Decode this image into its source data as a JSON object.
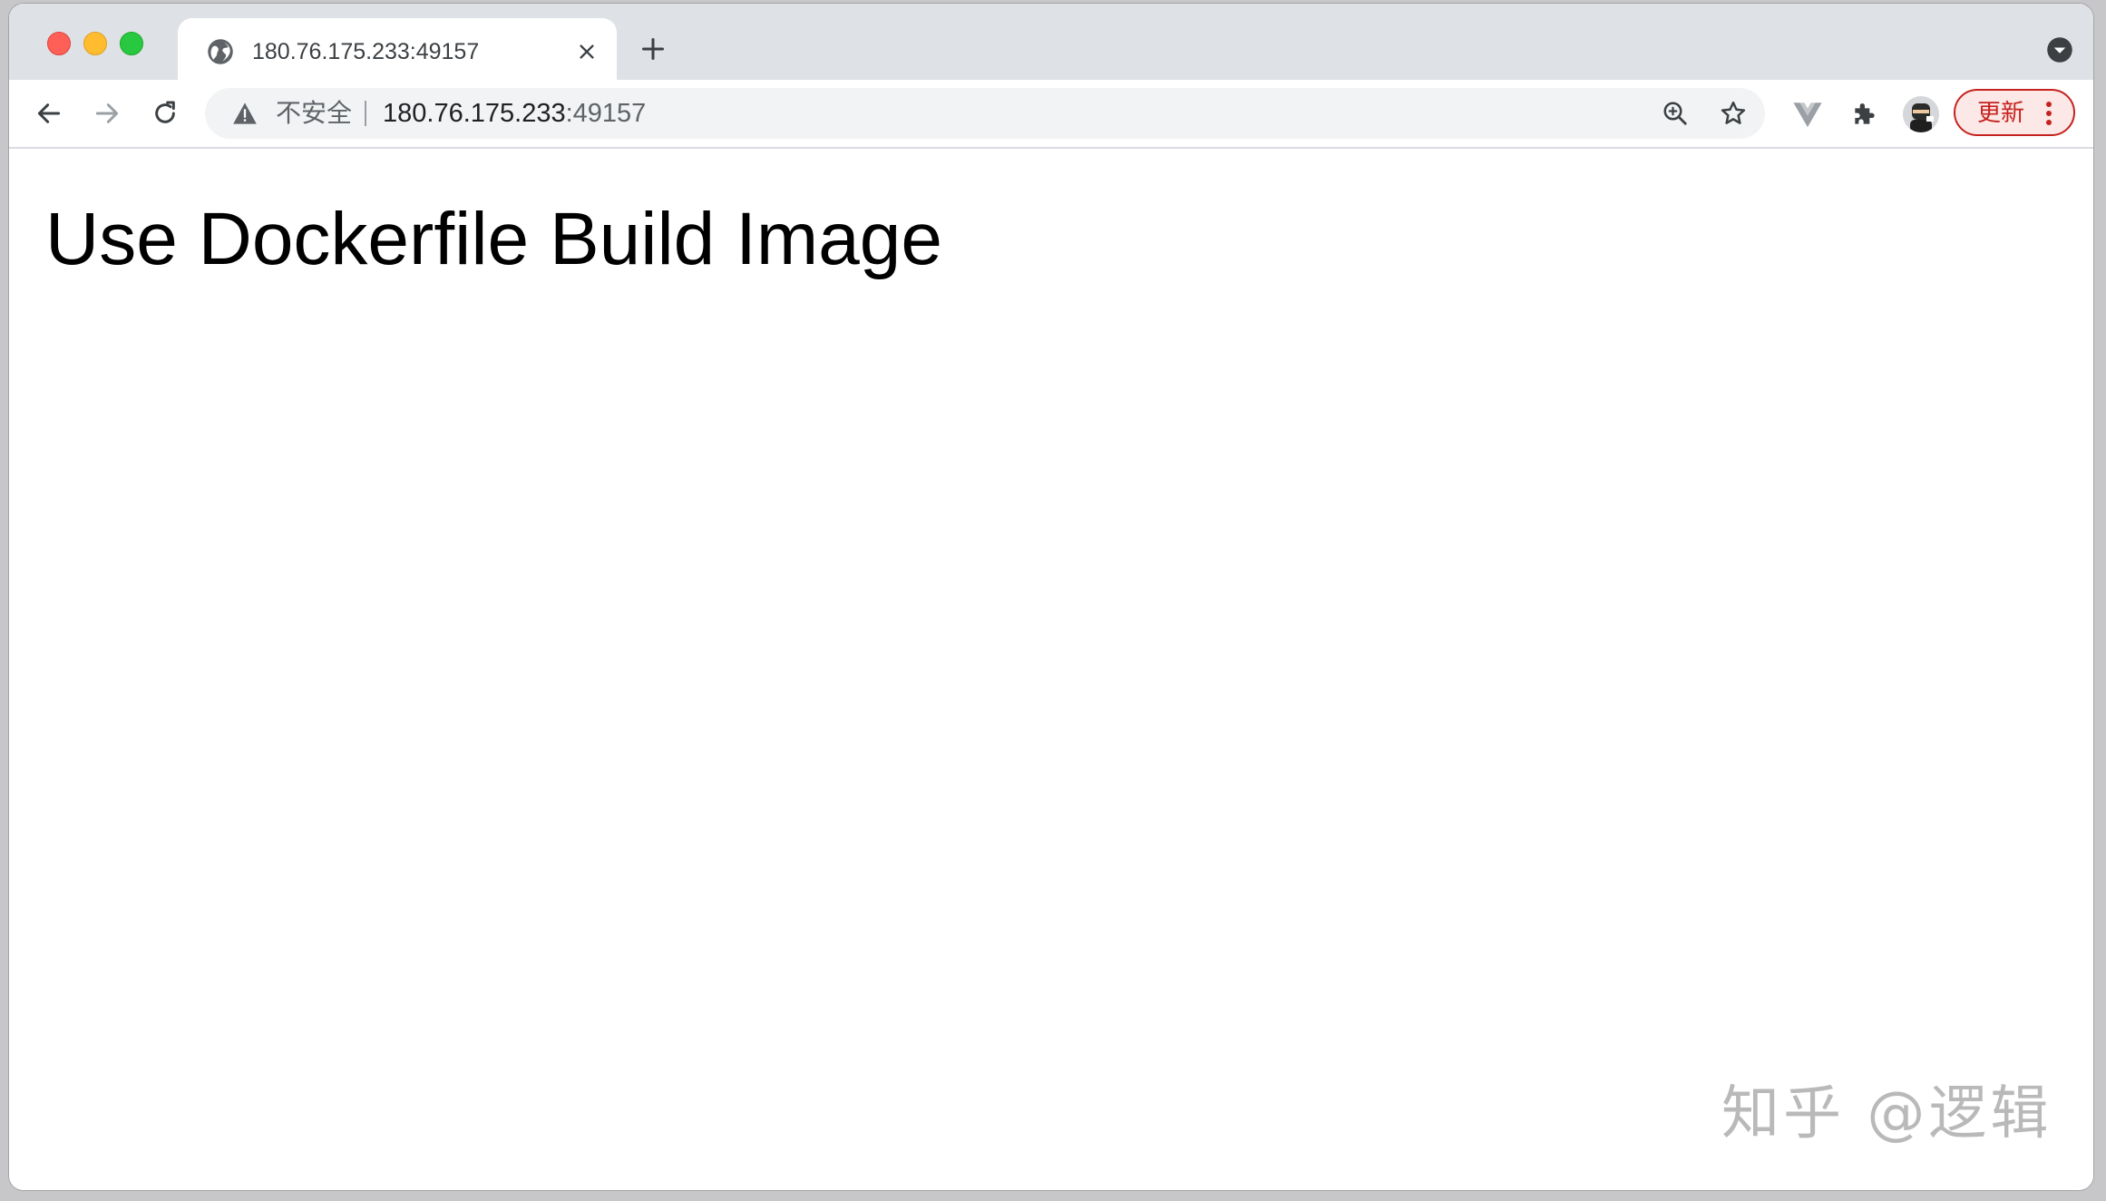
{
  "tab": {
    "title": "180.76.175.233:49157"
  },
  "address_bar": {
    "security_label": "不安全",
    "url_host": "180.76.175.233",
    "url_port": ":49157"
  },
  "toolbar": {
    "update_label": "更新"
  },
  "page": {
    "heading": "Use Dockerfile Build Image"
  },
  "watermark": {
    "text": "知乎 @逻辑"
  },
  "colors": {
    "tabstrip_bg": "#dee1e6",
    "update_accent": "#c5221f"
  }
}
